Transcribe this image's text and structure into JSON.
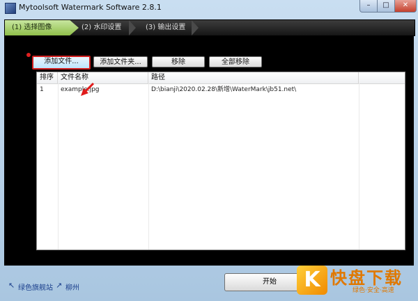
{
  "window": {
    "title": "Mytoolsoft Watermark Software 2.8.1",
    "min_label": "–",
    "max_label": "□",
    "close_label": "✕"
  },
  "steps": [
    {
      "label": "(1) 选择图像",
      "active": true
    },
    {
      "label": "(2) 水印设置",
      "active": false
    },
    {
      "label": "(3) 输出设置",
      "active": false
    }
  ],
  "toolbar": {
    "add_file": "添加文件...",
    "add_folder": "添加文件夹...",
    "remove": "移除",
    "remove_all": "全部移除"
  },
  "list": {
    "columns": [
      "排序",
      "文件名称",
      "路径"
    ],
    "rows": [
      {
        "order": "1",
        "name": "example.jpg",
        "path": "D:\\bianji\\2020.02.28\\新增\\WaterMark\\jb51.net\\"
      }
    ]
  },
  "bottom": {
    "link1": "绿色旗舰站",
    "link2": "柳州",
    "start_button": "开始"
  },
  "watermark": {
    "logo_letter": "K",
    "logo_text": "快盘下载",
    "logo_sub": "绿色·安全·高速"
  },
  "colors": {
    "active_step": "#8fbf4a",
    "highlight": "#d11d1d",
    "panel_bg": "#000000"
  }
}
